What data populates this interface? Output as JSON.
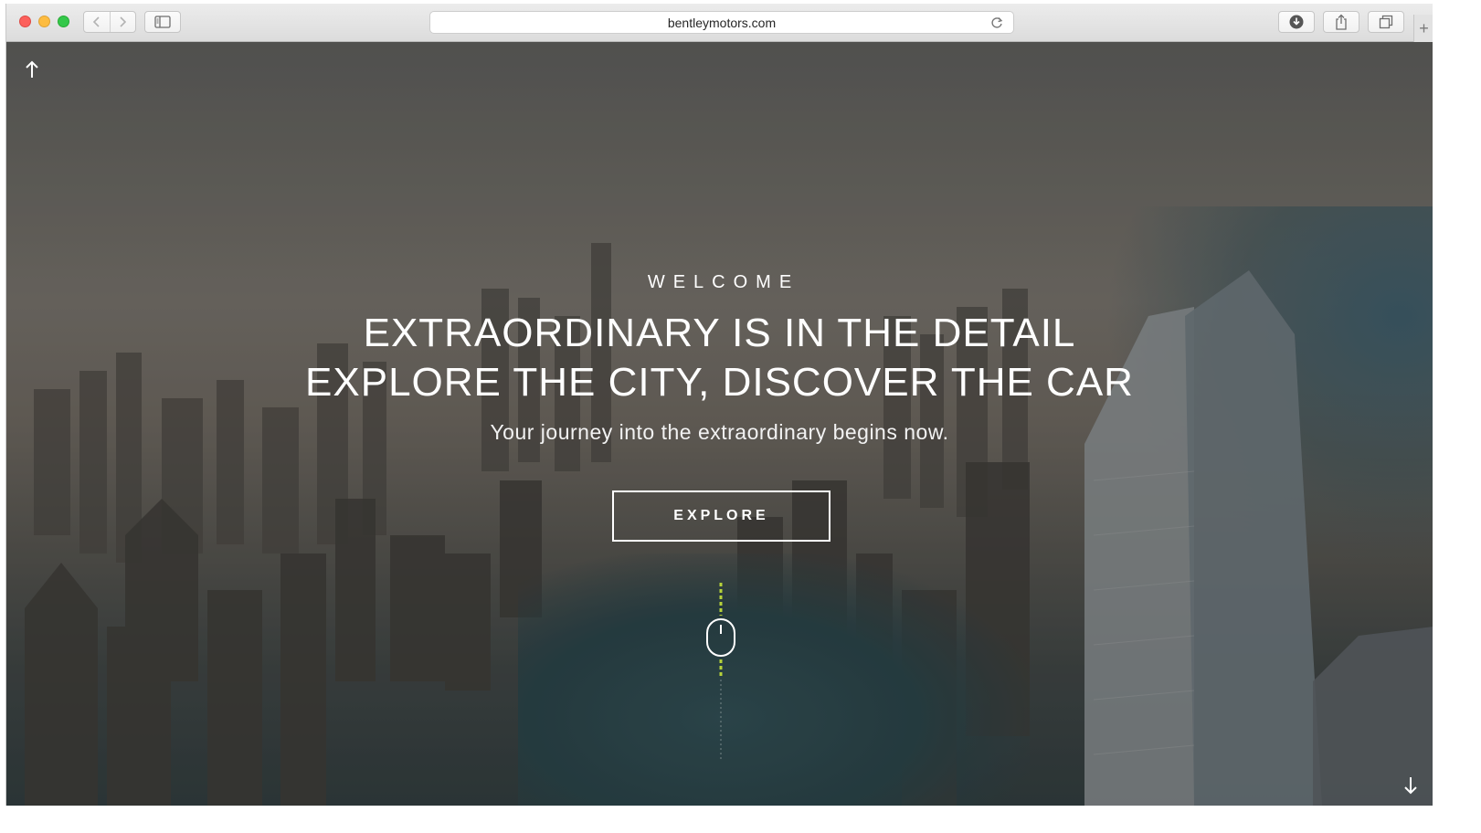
{
  "browser": {
    "url": "bentleymotors.com",
    "new_tab_symbol": "+"
  },
  "hero": {
    "eyebrow": "WELCOME",
    "headline_line1": "EXTRAORDINARY IS IN THE DETAIL",
    "headline_line2": "EXPLORE THE CITY, DISCOVER THE CAR",
    "subheading": "Your journey into the extraordinary begins now.",
    "cta_label": "EXPLORE"
  },
  "icons": {
    "scroll_up": "arrow-up-icon",
    "scroll_down": "arrow-down-icon",
    "scroll_hint": "mouse-icon"
  },
  "colors": {
    "text": "#ffffff",
    "scroll_accent": "#b7d33a"
  }
}
